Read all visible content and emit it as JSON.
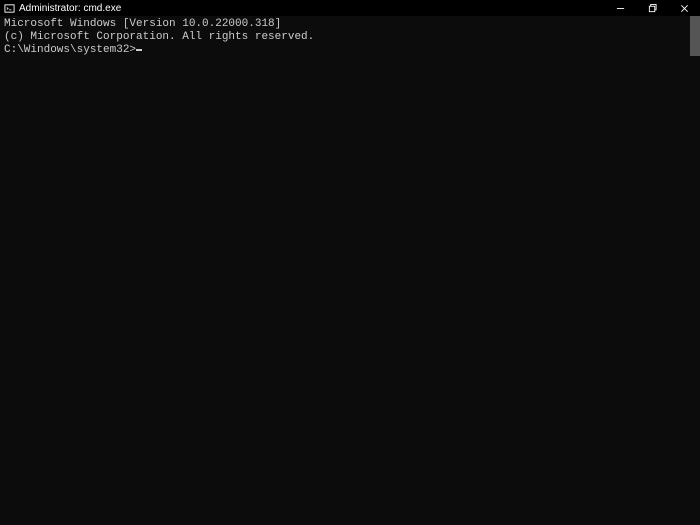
{
  "titlebar": {
    "title": "Administrator: cmd.exe"
  },
  "terminal": {
    "line1": "Microsoft Windows [Version 10.0.22000.318]",
    "line2": "(c) Microsoft Corporation. All rights reserved.",
    "blank": "",
    "prompt": "C:\\Windows\\system32>"
  }
}
